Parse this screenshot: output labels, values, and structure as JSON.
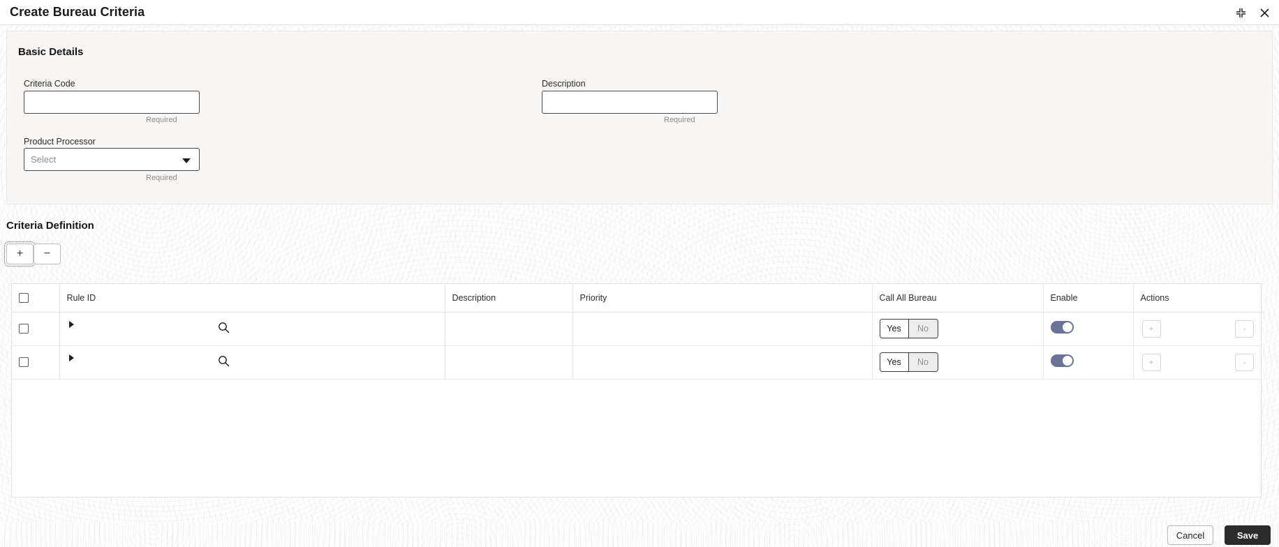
{
  "window": {
    "title": "Create Bureau Criteria",
    "collapse_icon": "collapse-corners-icon",
    "close_icon": "close-icon"
  },
  "basic_details": {
    "section_title": "Basic Details",
    "fields": [
      {
        "label": "Criteria Code",
        "value": "",
        "placeholder": "",
        "hint": "Required"
      },
      {
        "label": "Description",
        "value": "",
        "placeholder": "",
        "hint": "Required"
      },
      {
        "label": "Product Processor",
        "value": "Select",
        "hint": "Required",
        "caret_icon": "chevron-down-icon"
      }
    ]
  },
  "criteria_definition": {
    "section_title": "Criteria Definition",
    "toolbar": {
      "add_label": "+",
      "remove_label": "−"
    },
    "columns": [
      "",
      "Rule ID",
      "Description",
      "Priority",
      "Call All Bureau",
      "Enable",
      "Actions"
    ],
    "segmented": {
      "yes_label": "Yes",
      "no_label": "No"
    },
    "row_actions": {
      "add_label": "+",
      "remove_label": "-"
    },
    "rows": [
      {
        "selected": false,
        "rule_id": "",
        "description": "",
        "priority": "",
        "call_all_bureau": "Yes",
        "enable": true,
        "expander_icon": "expand-triangle-icon",
        "search_icon": "search-icon"
      },
      {
        "selected": false,
        "rule_id": "",
        "description": "",
        "priority": "",
        "call_all_bureau": "Yes",
        "enable": true,
        "expander_icon": "expand-triangle-icon",
        "search_icon": "search-icon"
      }
    ]
  },
  "footer": {
    "cancel_label": "Cancel",
    "save_label": "Save"
  },
  "colors": {
    "toggle_on": "#6a7396",
    "save_button_bg": "#2b2b2b",
    "panel_bg": "#f8f7f5",
    "hint_text": "#8a8a8a"
  }
}
